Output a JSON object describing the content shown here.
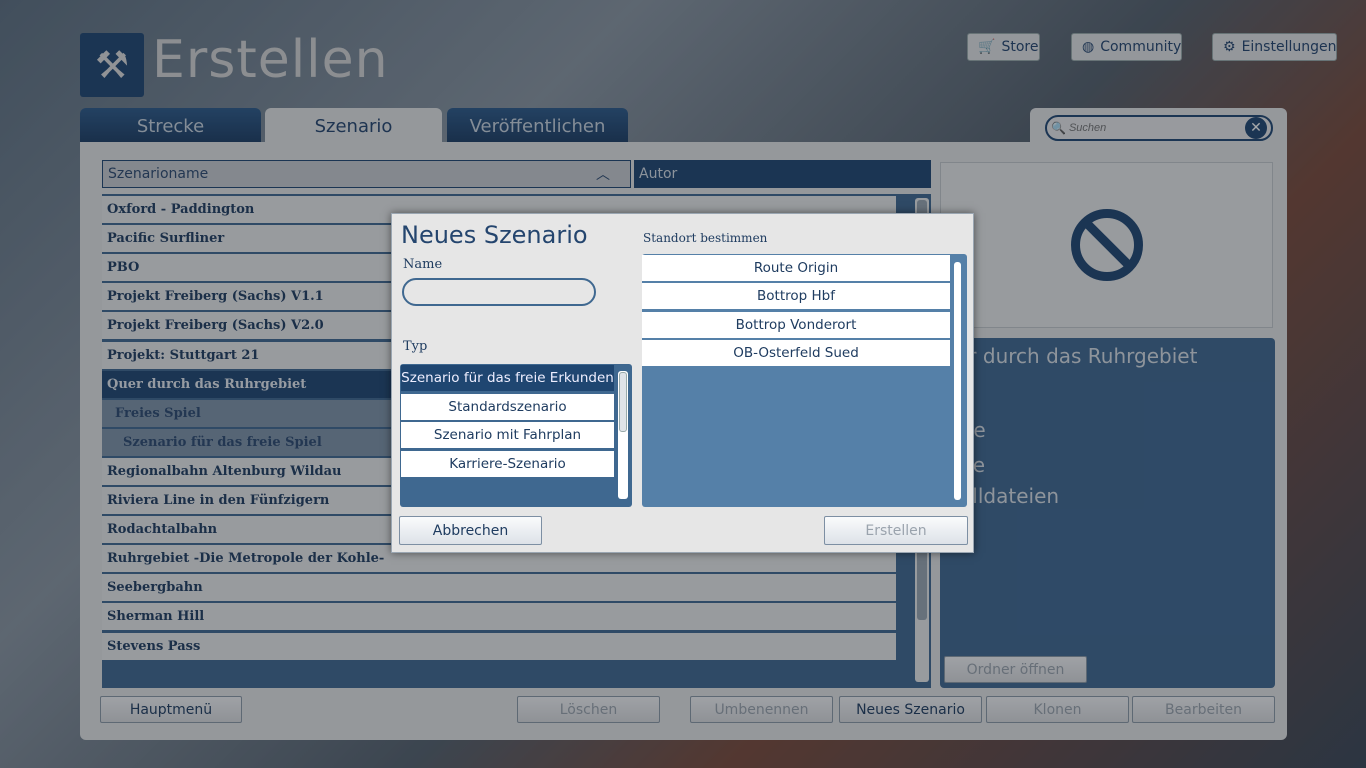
{
  "header": {
    "title": "Erstellen",
    "store": "Store",
    "community": "Community",
    "settings": "Einstellungen"
  },
  "tabs": [
    {
      "label": "Strecke"
    },
    {
      "label": "Szenario"
    },
    {
      "label": "Veröffentlichen"
    }
  ],
  "search": {
    "placeholder": "Suchen"
  },
  "list": {
    "col_name": "Szenarioname",
    "col_author": "Autor",
    "rows": [
      "Oxford - Paddington",
      "Pacific Surfliner",
      "PBO",
      "Projekt Freiberg (Sachs) V1.1",
      "Projekt Freiberg (Sachs) V2.0",
      "Projekt: Stuttgart 21",
      "Quer durch das Ruhrgebiet",
      "Freies Spiel",
      "Szenario für das freie Spiel",
      "Regionalbahn Altenburg Wildau",
      "Riviera Line in den Fünfzigern",
      "Rodachtalbahn",
      "Ruhrgebiet -Die Metropole der Kohle-",
      "Seebergbahn",
      "Sherman Hill",
      "Stevens Pass"
    ]
  },
  "details": {
    "title": "er durch das Ruhrgebiet",
    "line1": "ite",
    "line2": "ge",
    "line3": "elldateien",
    "open_folder": "Ordner öffnen"
  },
  "buttons": {
    "main_menu": "Hauptmenü",
    "delete": "Löschen",
    "rename": "Umbenennen",
    "new": "Neues Szenario",
    "clone": "Klonen",
    "edit": "Bearbeiten"
  },
  "dialog": {
    "title": "Neues Szenario",
    "name_label": "Name",
    "name_value": "",
    "type_label": "Typ",
    "types": [
      "Szenario für das freie Erkunden",
      "Standardszenario",
      "Szenario mit Fahrplan",
      "Karriere-Szenario"
    ],
    "location_label": "Standort bestimmen",
    "locations": [
      "Route Origin",
      "Bottrop Hbf",
      "Bottrop Vonderort",
      "OB-Osterfeld Sued"
    ],
    "cancel": "Abbrechen",
    "create": "Erstellen"
  }
}
